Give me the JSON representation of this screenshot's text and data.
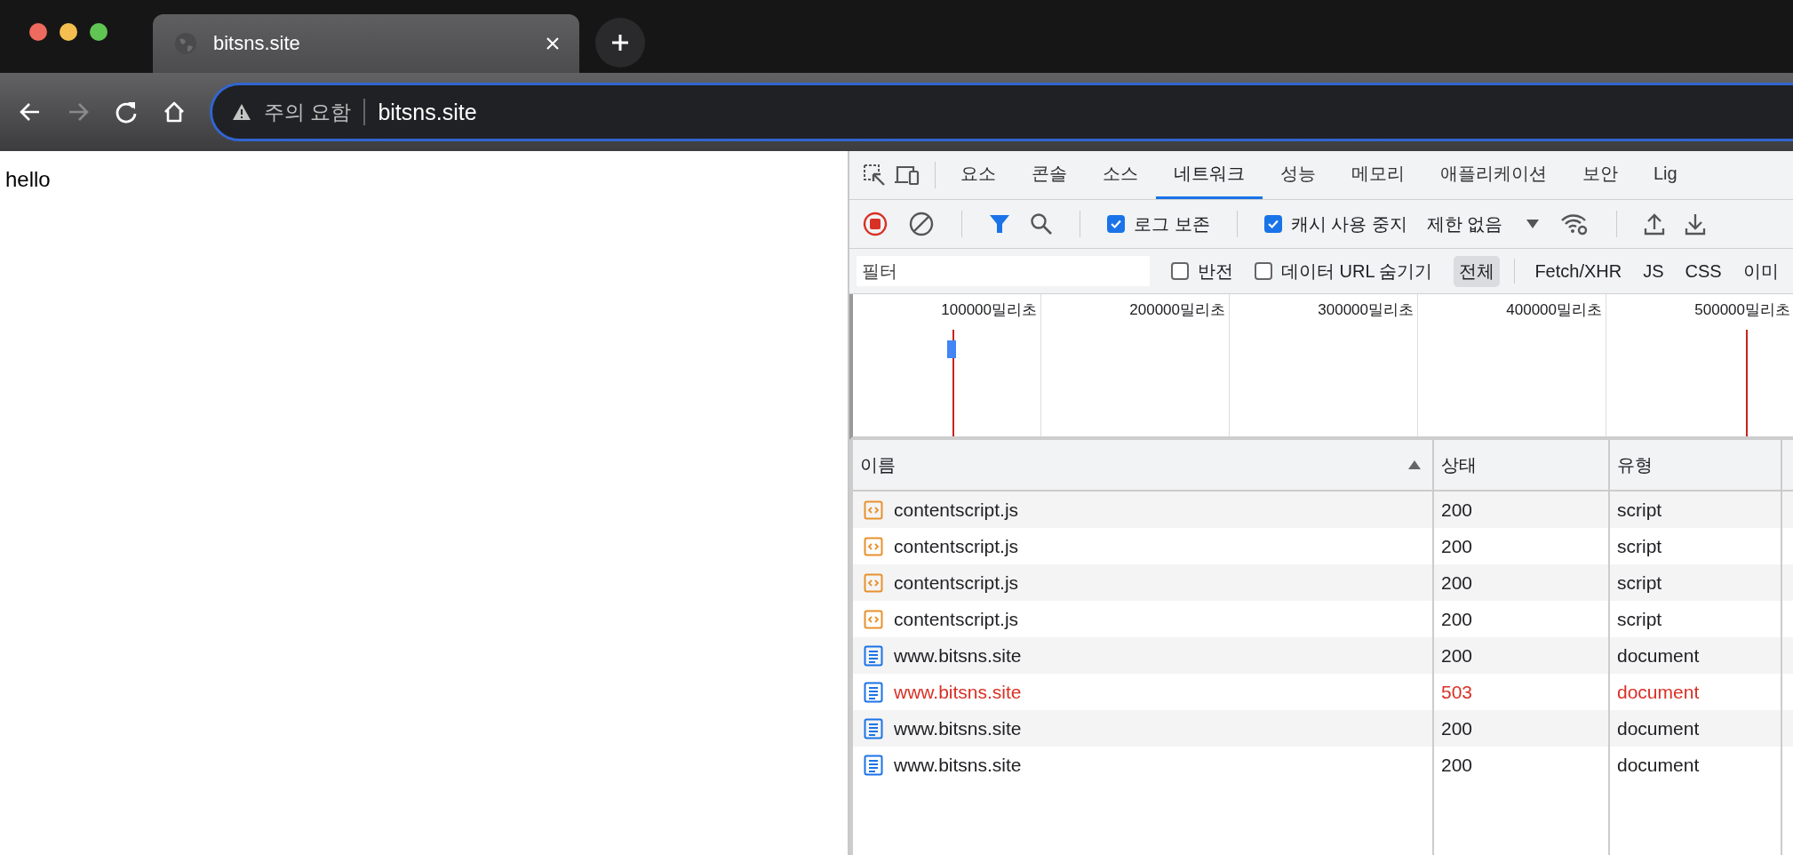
{
  "browser_tab": {
    "title": "bitsns.site"
  },
  "address_bar": {
    "security_label": "주의 요함",
    "url": "bitsns.site"
  },
  "nav": {
    "back_disabled": false,
    "forward_disabled": true
  },
  "page": {
    "text": "hello"
  },
  "devtools": {
    "tabs": [
      {
        "label": "요소",
        "selected": false
      },
      {
        "label": "콘솔",
        "selected": false
      },
      {
        "label": "소스",
        "selected": false
      },
      {
        "label": "네트워크",
        "selected": true
      },
      {
        "label": "성능",
        "selected": false
      },
      {
        "label": "메모리",
        "selected": false
      },
      {
        "label": "애플리케이션",
        "selected": false
      },
      {
        "label": "보안",
        "selected": false
      },
      {
        "label": "Lig",
        "selected": false
      }
    ],
    "toolbar": {
      "recording": true,
      "filter_active": true,
      "preserve_log": {
        "label": "로그 보존",
        "checked": true
      },
      "disable_cache": {
        "label": "캐시 사용 중지",
        "checked": true
      },
      "throttling": "제한 없음"
    },
    "filter": {
      "placeholder": "필터",
      "invert": {
        "label": "반전",
        "checked": false
      },
      "hide_data_urls": {
        "label": "데이터 URL 숨기기",
        "checked": false
      },
      "types": [
        {
          "label": "전체",
          "selected": true
        },
        {
          "label": "Fetch/XHR",
          "selected": false
        },
        {
          "label": "JS",
          "selected": false
        },
        {
          "label": "CSS",
          "selected": false
        },
        {
          "label": "이미",
          "selected": false
        }
      ]
    },
    "timeline": {
      "ticks": [
        "100000밀리초",
        "200000밀리초",
        "300000밀리초",
        "400000밀리초",
        "500000밀리초"
      ]
    },
    "table": {
      "columns": [
        {
          "label": "이름",
          "sorted": true
        },
        {
          "label": "상태",
          "sorted": false
        },
        {
          "label": "유형",
          "sorted": false
        }
      ],
      "rows": [
        {
          "kind": "script",
          "name": "contentscript.js",
          "status": "200",
          "type": "script",
          "error": false
        },
        {
          "kind": "script",
          "name": "contentscript.js",
          "status": "200",
          "type": "script",
          "error": false
        },
        {
          "kind": "script",
          "name": "contentscript.js",
          "status": "200",
          "type": "script",
          "error": false
        },
        {
          "kind": "script",
          "name": "contentscript.js",
          "status": "200",
          "type": "script",
          "error": false
        },
        {
          "kind": "document",
          "name": "www.bitsns.site",
          "status": "200",
          "type": "document",
          "error": false
        },
        {
          "kind": "document",
          "name": "www.bitsns.site",
          "status": "503",
          "type": "document",
          "error": true
        },
        {
          "kind": "document",
          "name": "www.bitsns.site",
          "status": "200",
          "type": "document",
          "error": false
        },
        {
          "kind": "document",
          "name": "www.bitsns.site",
          "status": "200",
          "type": "document",
          "error": false
        }
      ]
    }
  }
}
